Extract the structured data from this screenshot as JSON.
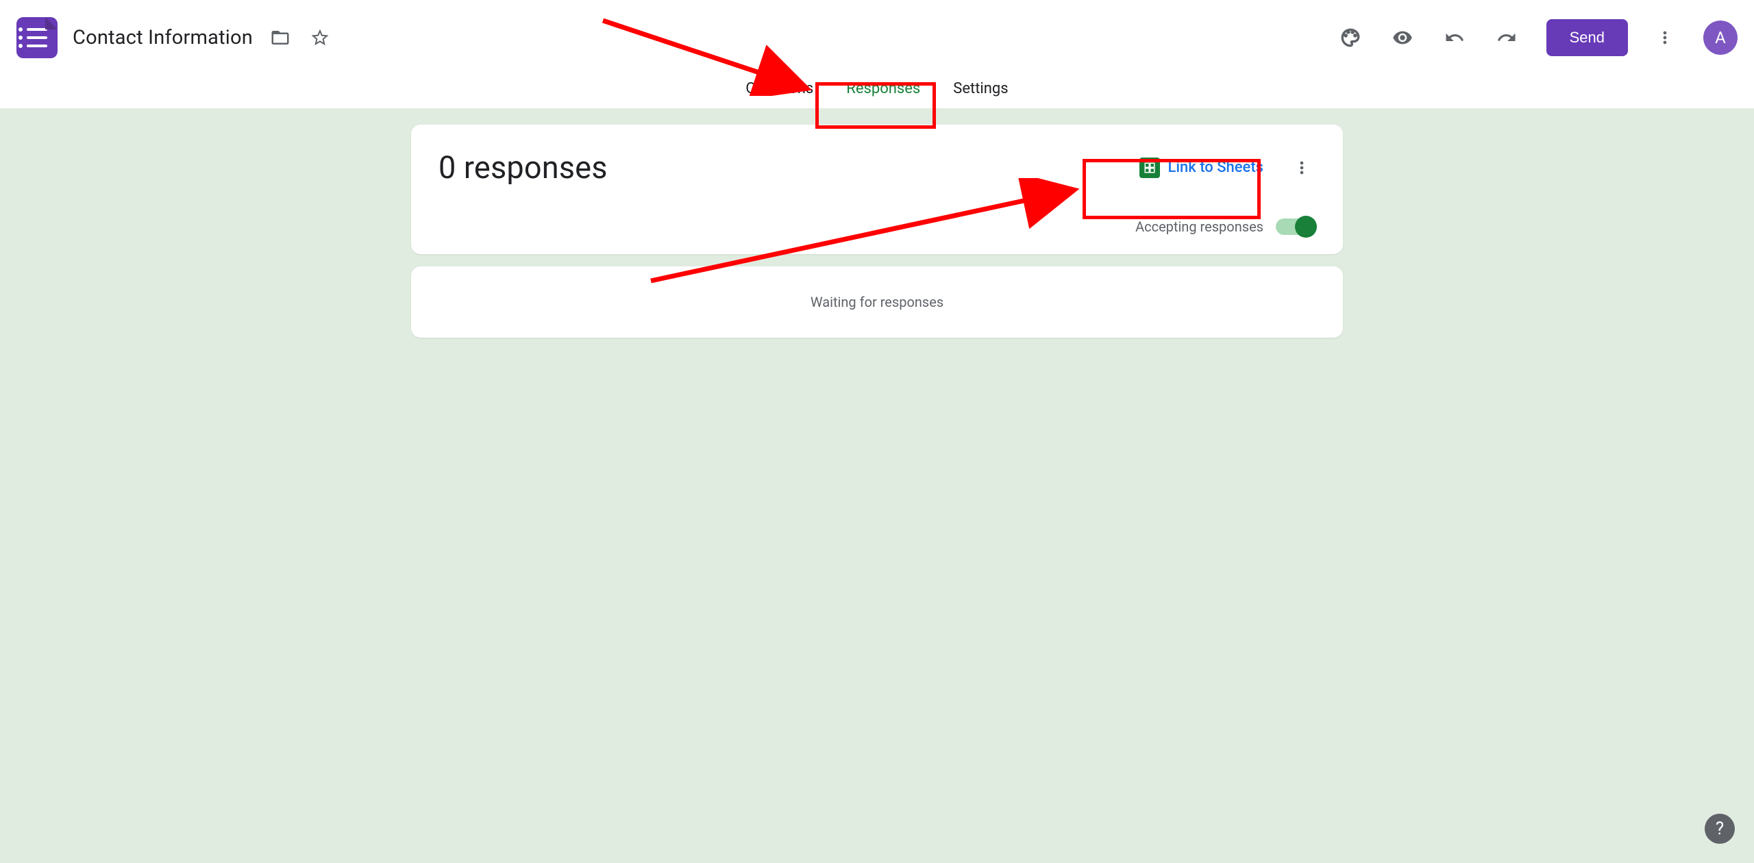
{
  "header": {
    "form_title": "Contact Information",
    "send_label": "Send",
    "avatar_letter": "A"
  },
  "tabs": {
    "questions": "Questions",
    "responses": "Responses",
    "settings": "Settings",
    "active": "responses"
  },
  "responses_card": {
    "title": "0 responses",
    "link_to_sheets": "Link to Sheets",
    "accepting_label": "Accepting responses",
    "accepting_on": true
  },
  "waiting_card": {
    "message": "Waiting for responses"
  },
  "help": {
    "symbol": "?"
  },
  "colors": {
    "brand": "#673ab7",
    "green": "#188038",
    "link": "#1a73e8",
    "bg_tint": "#e1ece1",
    "annotation": "#ff0000"
  }
}
